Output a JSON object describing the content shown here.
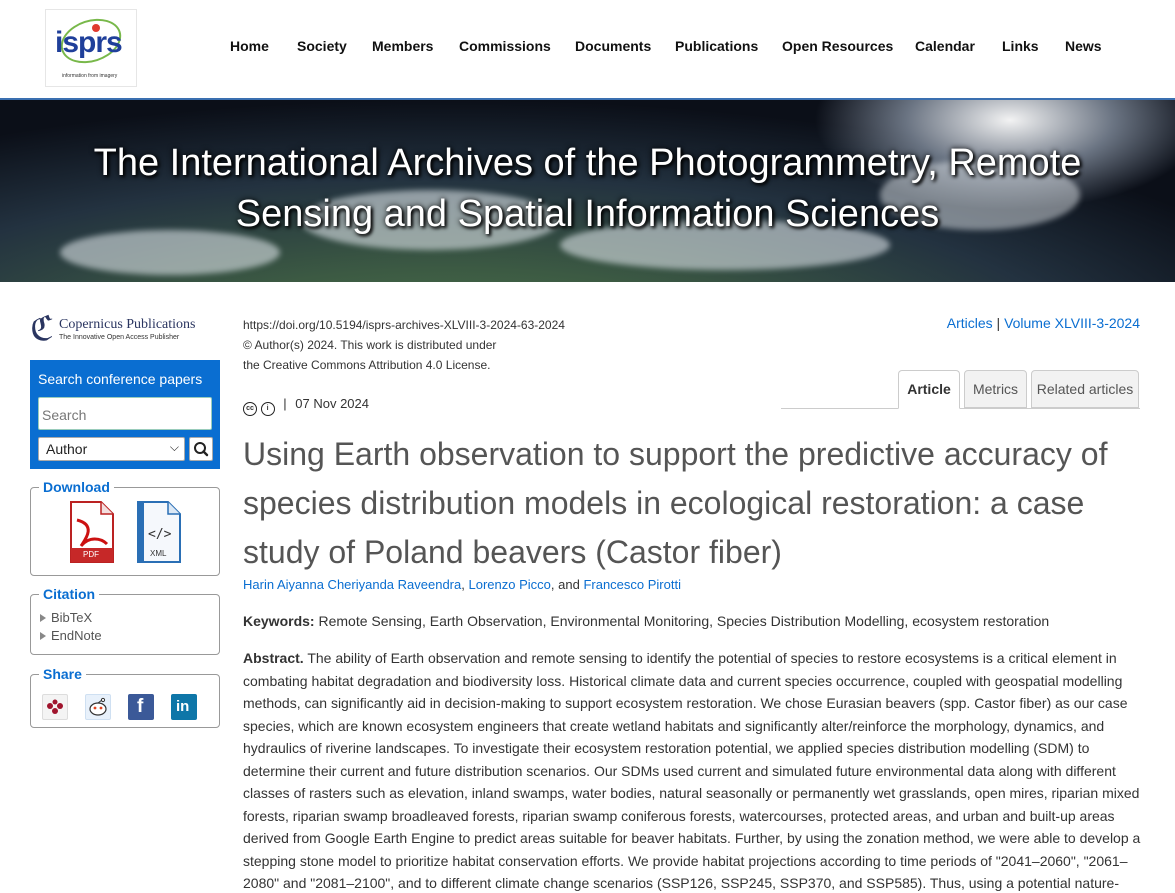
{
  "nav": {
    "logo_text": "isprs",
    "logo_tagline": "information from imagery",
    "items": [
      "Home",
      "Society",
      "Members",
      "Commissions",
      "Documents",
      "Publications",
      "Open Resources",
      "Calendar",
      "Links",
      "News"
    ]
  },
  "banner": {
    "line1": "The International Archives of the Photogrammetry, Remote",
    "line2": "Sensing and Spatial Information Sciences"
  },
  "sidebar": {
    "publisher_name": "Copernicus Publications",
    "publisher_tagline": "The Innovative Open Access Publisher",
    "search": {
      "title": "Search conference papers",
      "placeholder": "Search",
      "field_value": "Author"
    },
    "download": {
      "legend": "Download",
      "pdf_label": "PDF",
      "xml_label": "XML"
    },
    "citation": {
      "legend": "Citation",
      "items": [
        "BibTeX",
        "EndNote"
      ]
    },
    "share": {
      "legend": "Share",
      "icons": [
        "mendeley-icon",
        "reddit-icon",
        "facebook-icon",
        "linkedin-icon"
      ]
    }
  },
  "article": {
    "doi": "https://doi.org/10.5194/isprs-archives-XLVIII-3-2024-63-2024",
    "copyright": "© Author(s) 2024. This work is distributed under",
    "license": "the Creative Commons Attribution 4.0 License.",
    "breadcrumb_articles": "Articles",
    "breadcrumb_sep": " | ",
    "breadcrumb_volume": "Volume XLVIII-3-2024",
    "tabs": [
      "Article",
      "Metrics",
      "Related articles"
    ],
    "cc_icon_1": "cc",
    "cc_icon_2": "i",
    "date": "07 Nov 2024",
    "date_sep": "|",
    "title": "Using Earth observation to support the predictive accuracy of species distribution models in ecological restoration: a case study of Poland beavers (Castor fiber)",
    "authors": [
      "Harin Aiyanna Cheriyanda Raveendra",
      "Lorenzo Picco",
      "Francesco Pirotti"
    ],
    "author_sep": ",",
    "author_and": ", and",
    "keywords_label": "Keywords:",
    "keywords": "Remote Sensing, Earth Observation, Environmental Monitoring, Species Distribution Modelling, ecosystem restoration",
    "abstract_label": "Abstract.",
    "abstract": "The ability of Earth observation and remote sensing to identify the potential of species to restore ecosystems is a critical element in combating habitat degradation and biodiversity loss. Historical climate data and current species occurrence, coupled with geospatial modelling methods, can significantly aid in decision-making to support ecosystem restoration. We chose Eurasian beavers (spp. Castor fiber) as our case species, which are known ecosystem engineers that create wetland habitats and significantly alter/reinforce the morphology, dynamics, and hydraulics of riverine landscapes. To investigate their ecosystem restoration potential, we applied species distribution modelling (SDM) to determine their current and future distribution scenarios. Our SDMs used current and simulated future environmental data along with different classes of rasters such as elevation, inland swamps, water bodies, natural seasonally or permanently wet grasslands, open mires, riparian mixed forests, riparian swamp broadleaved forests, riparian swamp coniferous forests, watercourses, protected areas, and urban and built-up areas derived from Google Earth Engine to predict areas suitable for beaver habitats. Further, by using the zonation method, we were able to develop a stepping stone model to prioritize habitat conservation efforts. We provide habitat projections according to time periods of \"2041–2060\", \"2061–2080\" and \"2081–2100\", and to different climate change scenarios (SSP126, SSP245, SSP370, and SSP585). Thus, using a potential nature-"
  },
  "colors": {
    "accent": "#0a6ed1",
    "nav_border": "#3a6fb0"
  }
}
